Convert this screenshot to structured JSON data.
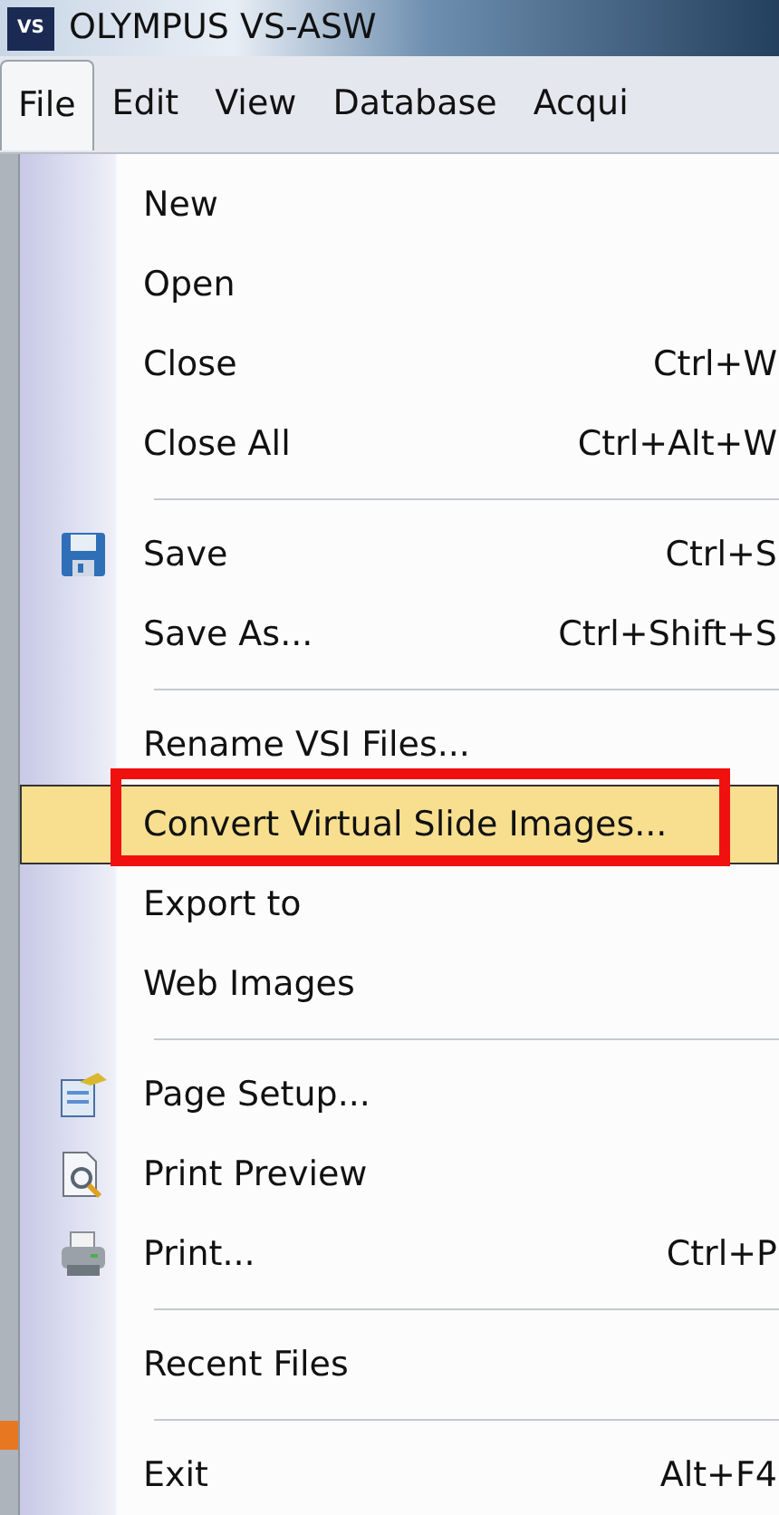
{
  "window": {
    "title": "OLYMPUS VS-ASW",
    "logo": "VS"
  },
  "menubar": [
    {
      "label": "File",
      "selected": true
    },
    {
      "label": "Edit",
      "selected": false
    },
    {
      "label": "View",
      "selected": false
    },
    {
      "label": "Database",
      "selected": false
    },
    {
      "label": "Acqui",
      "selected": false
    }
  ],
  "menu": [
    {
      "kind": "item",
      "label": "New",
      "selected": false,
      "annotated": false
    },
    {
      "kind": "item",
      "label": "Open",
      "selected": false,
      "annotated": false
    },
    {
      "kind": "item",
      "label": "Close",
      "shortcut": "Ctrl+W",
      "selected": false,
      "annotated": false
    },
    {
      "kind": "item",
      "label": "Close All",
      "shortcut": "Ctrl+Alt+W",
      "selected": false,
      "annotated": false
    },
    {
      "kind": "separator"
    },
    {
      "kind": "save",
      "label": "Save",
      "shortcut": "Ctrl+S",
      "selected": false,
      "annotated": false
    },
    {
      "kind": "item",
      "label": "Save As...",
      "shortcut": "Ctrl+Shift+S",
      "selected": false,
      "annotated": false
    },
    {
      "kind": "separator"
    },
    {
      "kind": "item",
      "label": "Rename VSI Files...",
      "selected": false,
      "annotated": false
    },
    {
      "kind": "item",
      "label": "Convert Virtual Slide Images...",
      "selected": true,
      "annotated": true
    },
    {
      "kind": "item",
      "label": "Export to",
      "selected": false,
      "annotated": false
    },
    {
      "kind": "item",
      "label": "Web Images",
      "selected": false,
      "annotated": false
    },
    {
      "kind": "separator"
    },
    {
      "kind": "setup",
      "label": "Page Setup...",
      "selected": false,
      "annotated": false
    },
    {
      "kind": "preview",
      "label": "Print Preview",
      "selected": false,
      "annotated": false
    },
    {
      "kind": "print",
      "label": "Print...",
      "shortcut": "Ctrl+P",
      "selected": false,
      "annotated": false
    },
    {
      "kind": "separator"
    },
    {
      "kind": "item",
      "label": "Recent Files",
      "selected": false,
      "annotated": false
    },
    {
      "kind": "separator"
    },
    {
      "kind": "item",
      "label": "Exit",
      "shortcut": "Alt+F4",
      "selected": false,
      "annotated": false
    }
  ]
}
